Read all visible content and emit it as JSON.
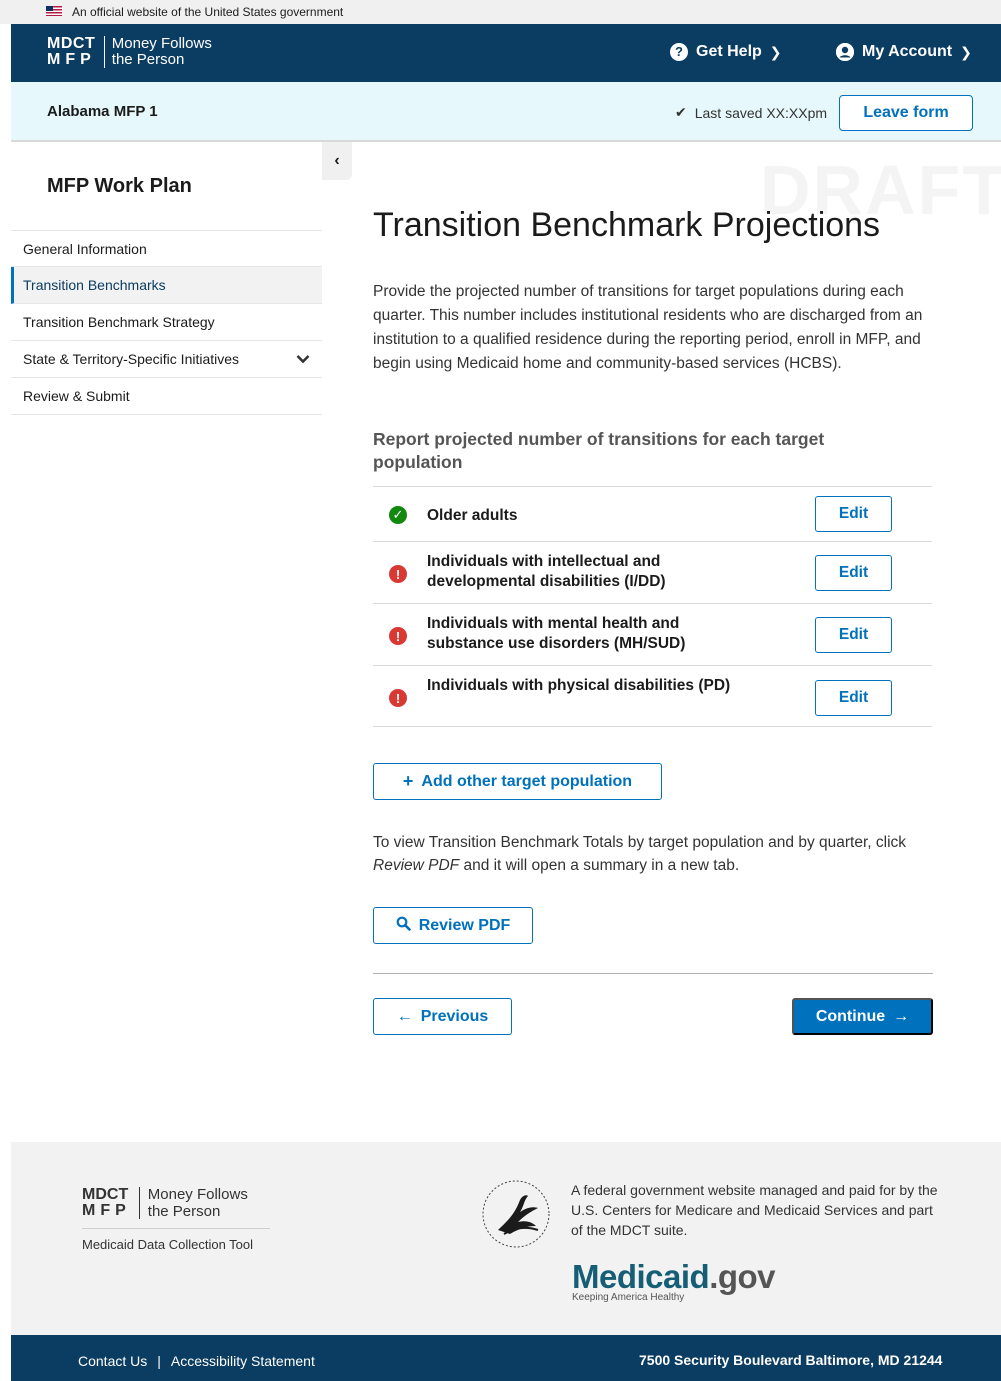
{
  "gov_banner": {
    "text": "An official website of the United States government"
  },
  "header": {
    "logo_line1": "MDCT",
    "logo_line2": "MFP",
    "logo_name_line1": "Money Follows",
    "logo_name_line2": "the Person",
    "help_label": "Get Help",
    "account_label": "My Account"
  },
  "subheader": {
    "report_name": "Alabama MFP 1",
    "saved_text": "Last saved XX:XXpm",
    "leave_label": "Leave form"
  },
  "sidebar": {
    "title": "MFP Work Plan",
    "collapse_glyph": "‹",
    "items": [
      {
        "label": "General Information",
        "active": false
      },
      {
        "label": "Transition Benchmarks",
        "active": true
      },
      {
        "label": "Transition Benchmark Strategy",
        "active": false
      },
      {
        "label": "State & Territory-Specific Initiatives",
        "active": false,
        "expandable": true
      },
      {
        "label": "Review & Submit",
        "active": false
      }
    ]
  },
  "main": {
    "watermark": "DRAFT",
    "title": "Transition Benchmark Projections",
    "intro": "Provide the projected number of transitions for target populations during each quarter. This number includes institutional residents who are discharged from an institution to a qualified residence during the reporting period, enroll in MFP, and begin using Medicaid home and community-based services (HCBS).",
    "section_title": "Report projected number of transitions for each target population",
    "populations": [
      {
        "label": "Older adults",
        "status": "complete",
        "edit_label": "Edit"
      },
      {
        "label": "Individuals with intellectual and developmental disabilities (I/DD)",
        "status": "error",
        "edit_label": "Edit"
      },
      {
        "label": "Individuals with mental health and substance use disorders (MH/SUD)",
        "status": "error",
        "edit_label": "Edit"
      },
      {
        "label": "Individuals with physical disabilities (PD)",
        "status": "error",
        "edit_label": "Edit"
      }
    ],
    "add_label": "Add other target population",
    "summary_before": "To view Transition Benchmark Totals by target population and by quarter, click ",
    "summary_em": "Review PDF",
    "summary_after": " and it will open a summary in a new tab.",
    "review_pdf_label": "Review PDF",
    "previous_label": "Previous",
    "continue_label": "Continue"
  },
  "footer": {
    "logo_line1": "MDCT",
    "logo_line2": "MFP",
    "logo_name_line1": "Money Follows",
    "logo_name_line2": "the Person",
    "tool_name": "Medicaid Data Collection Tool",
    "managed_text": "A federal government website managed and paid for by the U.S. Centers for Medicare and Medicaid Services and part of the MDCT suite.",
    "medicaid_main": "Medicaid",
    "medicaid_gov": ".gov",
    "medicaid_tagline": "Keeping America Healthy",
    "contact_label": "Contact Us",
    "separator": "|",
    "accessibility_label": "Accessibility Statement",
    "address": "7500 Security Boulevard Baltimore, MD 21244"
  },
  "colors": {
    "header_bg": "#0b3c61",
    "subheader_bg": "#e6f8fb",
    "primary": "#0071bc",
    "success": "#12890e",
    "error": "#d83933"
  }
}
